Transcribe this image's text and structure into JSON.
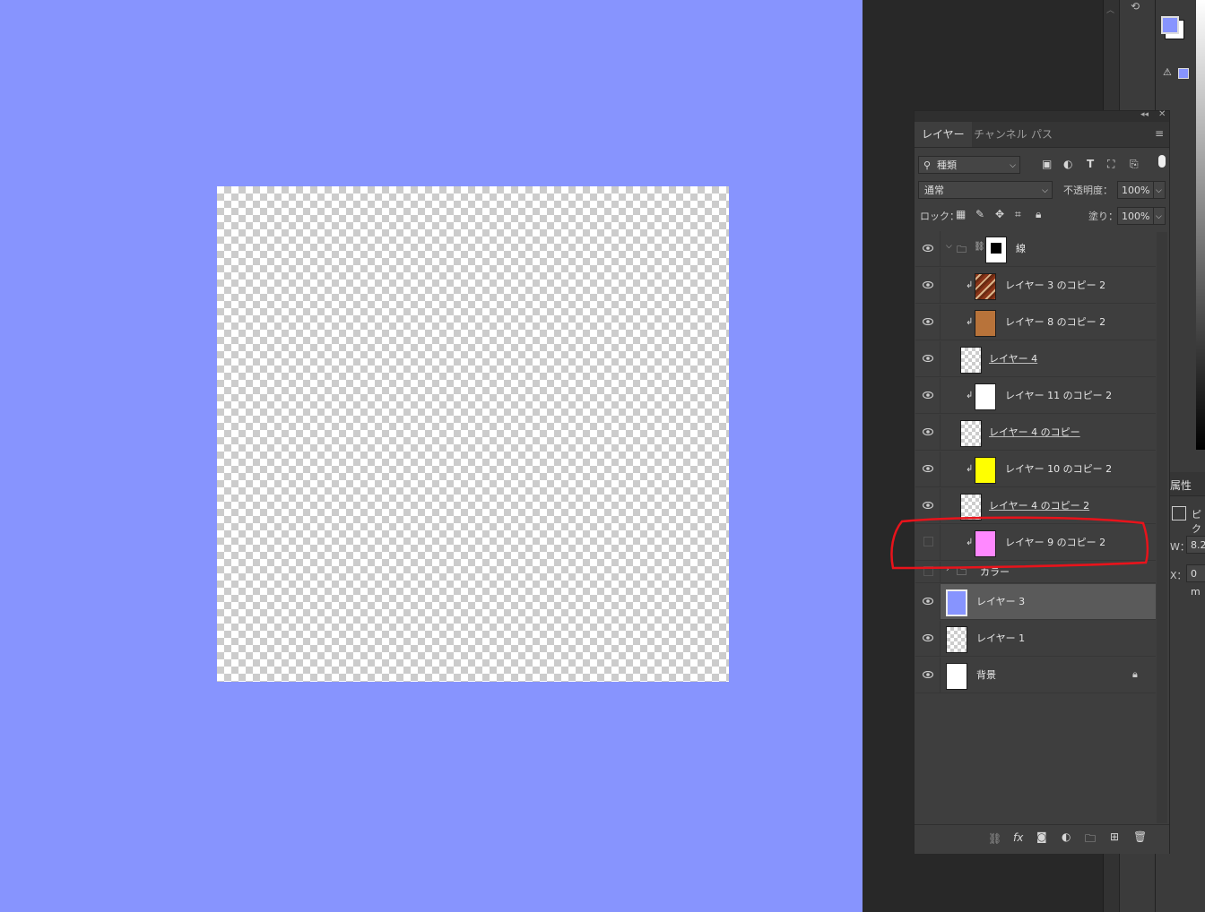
{
  "layers_panel": {
    "tabs": [
      {
        "label": "レイヤー"
      },
      {
        "label": "チャンネル"
      },
      {
        "label": "パス"
      }
    ],
    "filter": {
      "label": "種類"
    },
    "blend": {
      "mode": "通常",
      "opacity_label": "不透明度：",
      "opacity": "100%"
    },
    "lock": {
      "label": "ロック：",
      "fill_label": "塗り：",
      "fill": "100%"
    },
    "layers": [
      {
        "name": "線",
        "kind": "group-mask"
      },
      {
        "name": "レイヤー 3 のコピー 2",
        "clip": true
      },
      {
        "name": "レイヤー 8 のコピー 2",
        "clip": true,
        "color": "#b8733a"
      },
      {
        "name": "レイヤー 4"
      },
      {
        "name": "レイヤー 11 のコピー 2",
        "clip": true,
        "color": "#ffffff"
      },
      {
        "name": "レイヤー 4 のコピー"
      },
      {
        "name": "レイヤー 10 のコピー 2",
        "clip": true,
        "color": "#ffff00"
      },
      {
        "name": "レイヤー 4 のコピー 2"
      },
      {
        "name": "レイヤー 9 のコピー 2",
        "clip": true,
        "visible": false,
        "color": "#ff88ff"
      },
      {
        "name": "カラー",
        "kind": "group",
        "visible": false
      },
      {
        "name": "レイヤー 3",
        "selected": true,
        "color": "#8794fe"
      },
      {
        "name": "レイヤー 1"
      },
      {
        "name": "背景",
        "locked": true,
        "color": "#ffffff"
      }
    ]
  },
  "properties_panel": {
    "title": "属性",
    "pixel_label": "ピク",
    "w_label": "W：",
    "w_value": "8.2",
    "x_label": "X：",
    "x_value": "0 m"
  },
  "colors": {
    "canvas": "#8794fe",
    "highlight": "#e8131b",
    "foreground": "#8794fe"
  }
}
